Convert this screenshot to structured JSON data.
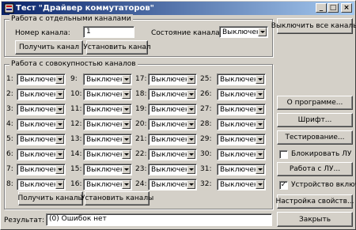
{
  "window": {
    "title": "Тест \"Драйвер коммутаторов\""
  },
  "single_group": {
    "legend": "Работа с отдельными каналами",
    "channel_number_label": "Номер канала:",
    "channel_number_value": "1",
    "channel_state_label": "Состояние канала:",
    "channel_state_value": "Выключен",
    "get_channel": "Получить канал",
    "set_channel": "Установить канал"
  },
  "multi_group": {
    "legend": "Работа с совокупностью каналов",
    "channels": [
      {
        "label": "1:",
        "value": "Выключен"
      },
      {
        "label": "2:",
        "value": "Выключен"
      },
      {
        "label": "3:",
        "value": "Выключен"
      },
      {
        "label": "4:",
        "value": "Выключен"
      },
      {
        "label": "5:",
        "value": "Выключен"
      },
      {
        "label": "6:",
        "value": "Выключен"
      },
      {
        "label": "7:",
        "value": "Выключен"
      },
      {
        "label": "8:",
        "value": "Выключен"
      },
      {
        "label": "9:",
        "value": "Выключен"
      },
      {
        "label": "10:",
        "value": "Выключен"
      },
      {
        "label": "11:",
        "value": "Выключен"
      },
      {
        "label": "12:",
        "value": "Выключен"
      },
      {
        "label": "13:",
        "value": "Выключен"
      },
      {
        "label": "14:",
        "value": "Выключен"
      },
      {
        "label": "15:",
        "value": "Выключен"
      },
      {
        "label": "16:",
        "value": "Выключен"
      },
      {
        "label": "17:",
        "value": "Выключен"
      },
      {
        "label": "18:",
        "value": "Выключен"
      },
      {
        "label": "19:",
        "value": "Выключен"
      },
      {
        "label": "20:",
        "value": "Выключен"
      },
      {
        "label": "21:",
        "value": "Выключен"
      },
      {
        "label": "22:",
        "value": "Выключен"
      },
      {
        "label": "23:",
        "value": "Выключен"
      },
      {
        "label": "24:",
        "value": "Выключен"
      },
      {
        "label": "25:",
        "value": "Выключен"
      },
      {
        "label": "26:",
        "value": "Выключен"
      },
      {
        "label": "27:",
        "value": "Выключен"
      },
      {
        "label": "28:",
        "value": "Выключен"
      },
      {
        "label": "29:",
        "value": "Выключен"
      },
      {
        "label": "30:",
        "value": "Выключен"
      },
      {
        "label": "31:",
        "value": "Выключен"
      },
      {
        "label": "32:",
        "value": "Выключен"
      }
    ],
    "get_channels": "Получить каналы",
    "set_channels": "Установить каналы"
  },
  "result": {
    "label": "Результат:",
    "value": "(0) Ошибок нет"
  },
  "right_panel": {
    "turn_off_all": "Выключить все каналы",
    "about": "О программе...",
    "font": "Шрифт...",
    "testing": "Тестирование...",
    "block_lu": "Блокировать ЛУ",
    "block_lu_checked": false,
    "work_with_lu": "Работа с ЛУ...",
    "device_on": "Устройство включено",
    "device_on_checked": true,
    "device_settings": "Настройка свойств...",
    "close": "Закрыть"
  }
}
